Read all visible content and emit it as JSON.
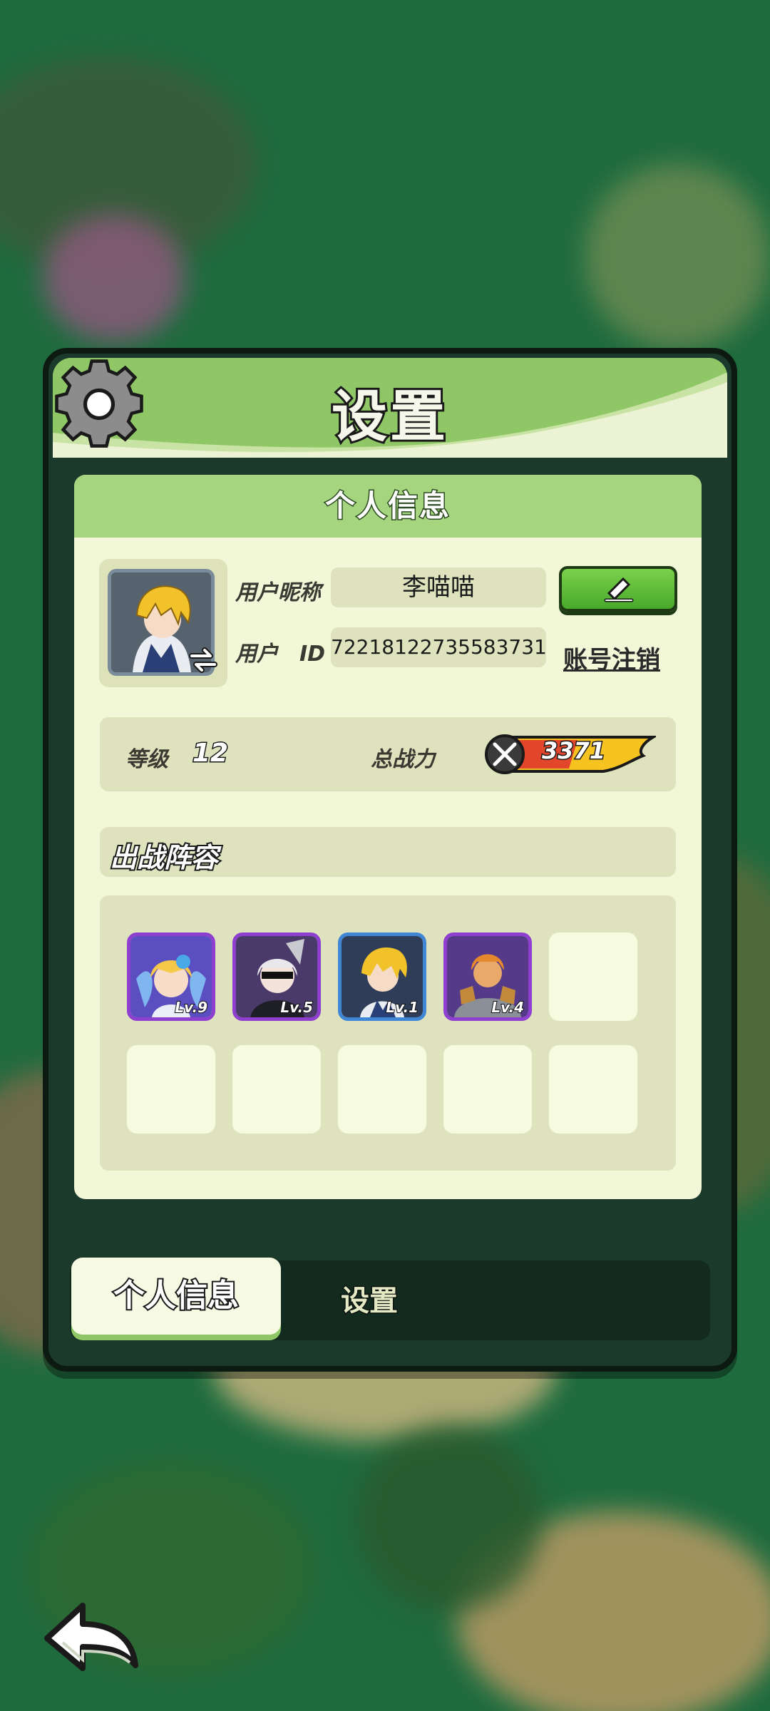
{
  "dialog": {
    "title": "设置",
    "section_title": "个人信息"
  },
  "profile": {
    "nickname_label": "用户昵称",
    "nickname": "李喵喵",
    "id_label": "用户　ID",
    "user_id": "72218122735583731",
    "cancel_account": "账号注销"
  },
  "stats": {
    "level_label": "等级",
    "level": "12",
    "power_label": "总战力",
    "power": "3371"
  },
  "lineup": {
    "title": "出战阵容",
    "heroes": [
      {
        "lv": "Lv.9",
        "frame": "#8e3fd0"
      },
      {
        "lv": "Lv.5",
        "frame": "#8e3fd0"
      },
      {
        "lv": "Lv.1",
        "frame": "#3f86d6"
      },
      {
        "lv": "Lv.4",
        "frame": "#8e3fd0"
      }
    ]
  },
  "tabs": {
    "profile": "个人信息",
    "settings": "设置"
  },
  "icons": [
    "gear-icon",
    "edit-icon",
    "swap-icon",
    "swords-icon",
    "back-arrow-icon"
  ],
  "colors": {
    "accent_green": "#8fc766",
    "panel": "#f2f7d8",
    "button_green": "#5cb83a"
  }
}
